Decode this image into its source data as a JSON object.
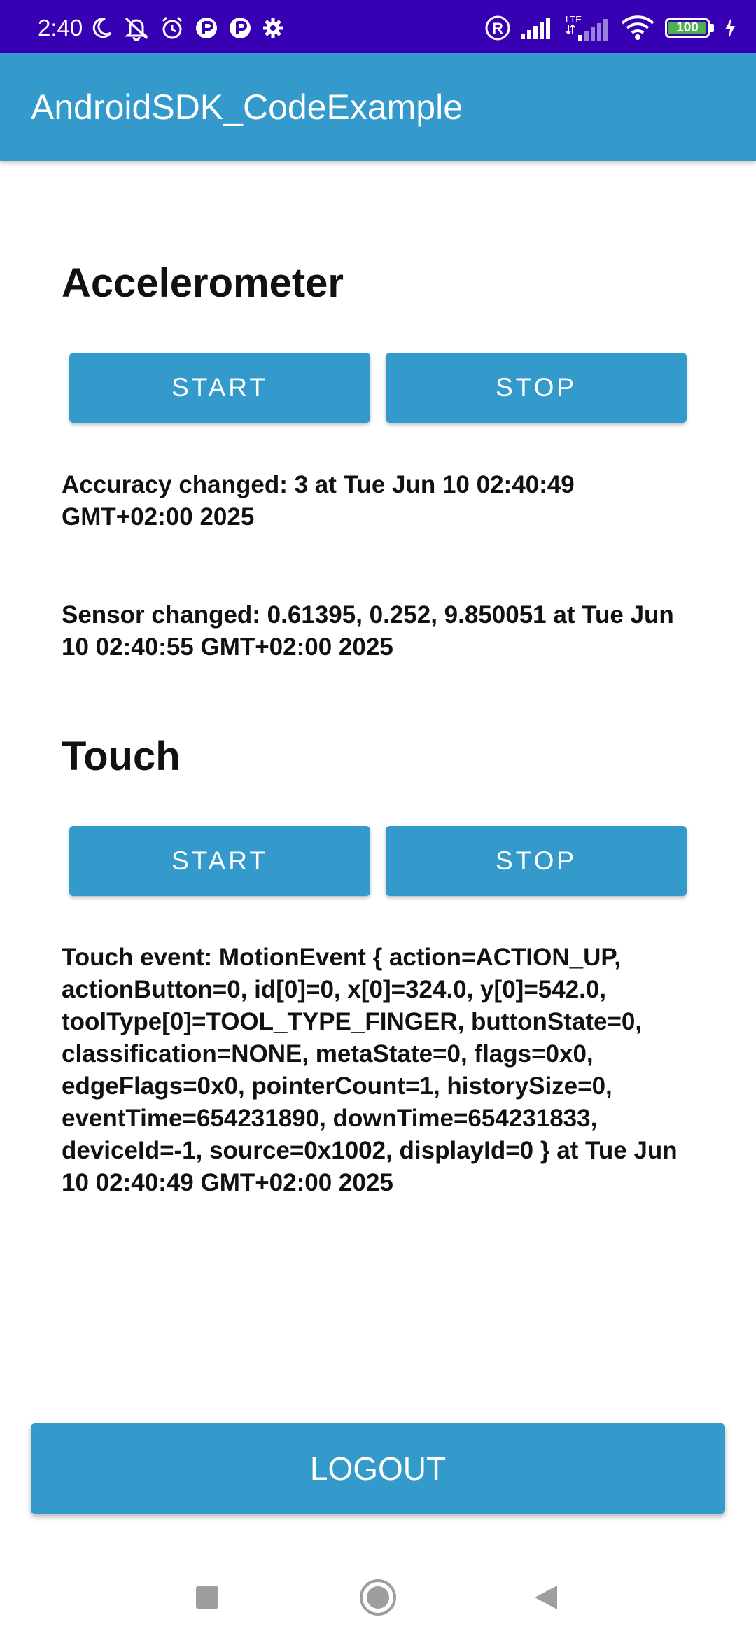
{
  "status_bar": {
    "time": "2:40",
    "battery_level": "100",
    "lte_label": "LTE",
    "roaming_label": "R",
    "icons_left": [
      "moon-icon",
      "bell-off-icon",
      "alarm-icon",
      "app-notification-icon",
      "app-notification-icon",
      "gear-icon"
    ],
    "icons_right": [
      "roaming-icon",
      "signal-icon",
      "lte-signal-icon",
      "wifi-icon",
      "battery-icon",
      "charging-icon"
    ],
    "colors": {
      "background": "#3700b3",
      "battery_fill": "#4caf50"
    }
  },
  "app_bar": {
    "title": "AndroidSDK_CodeExample",
    "color": "#349acb"
  },
  "accelerometer": {
    "title": "Accelerometer",
    "start_label": "START",
    "stop_label": "STOP",
    "accuracy_text": "Accuracy changed: 3 at Tue Jun 10 02:40:49 GMT+02:00 2025",
    "sensor_text": "Sensor changed: 0.61395, 0.252, 9.850051 at Tue Jun 10 02:40:55 GMT+02:00 2025"
  },
  "touch": {
    "title": "Touch",
    "start_label": "START",
    "stop_label": "STOP",
    "event_text": "Touch event: MotionEvent { action=ACTION_UP, actionButton=0, id[0]=0, x[0]=324.0, y[0]=542.0, toolType[0]=TOOL_TYPE_FINGER, buttonState=0, classification=NONE, metaState=0, flags=0x0, edgeFlags=0x0, pointerCount=1, historySize=0, eventTime=654231890, downTime=654231833, deviceId=-1, source=0x1002, displayId=0 } at Tue Jun 10 02:40:49 GMT+02:00 2025"
  },
  "logout": {
    "label": "LOGOUT"
  },
  "nav_bar": {
    "icons": [
      "recents-square-icon",
      "home-circle-icon",
      "back-triangle-icon"
    ]
  },
  "colors": {
    "accent": "#349acb",
    "text": "#111111"
  }
}
